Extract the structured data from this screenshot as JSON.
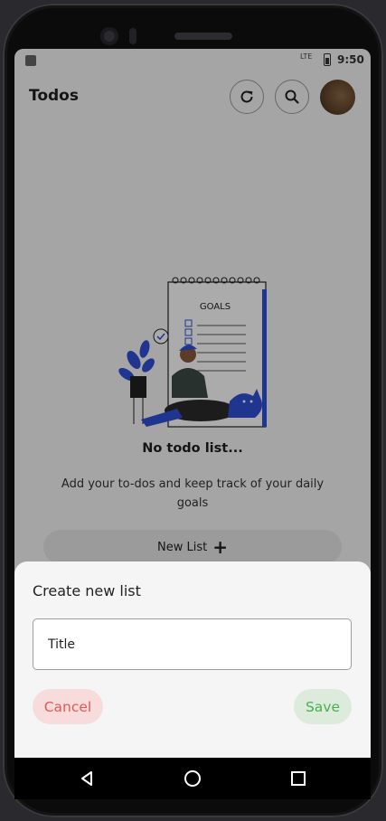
{
  "status_bar": {
    "network": "LTE",
    "time": "9:50"
  },
  "app_bar": {
    "title": "Todos",
    "icons": [
      "refresh-icon",
      "search-icon"
    ],
    "avatar": "user-avatar"
  },
  "illustration": {
    "heading": "GOALS"
  },
  "empty_state": {
    "title": "No todo list...",
    "description": "Add your to-dos and keep track of your daily goals",
    "new_list_label": "New List",
    "new_list_icon": "plus-icon"
  },
  "dialog": {
    "title": "Create new list",
    "field_placeholder": "Title",
    "field_value": "",
    "cancel_label": "Cancel",
    "save_label": "Save"
  },
  "nav_bar": {
    "buttons": [
      "back-icon",
      "home-icon",
      "recents-icon"
    ]
  },
  "colors": {
    "cancel_text": "#e45757",
    "cancel_bg": "#f8dcdc",
    "save_text": "#4caf50",
    "save_bg": "#dcebdc",
    "illustration_accent": "#2f4fd6"
  }
}
